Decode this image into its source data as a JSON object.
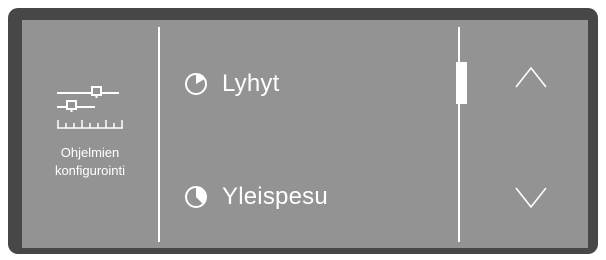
{
  "left_panel": {
    "icon": "settings-sliders-icon",
    "label_line1": "Ohjelmien",
    "label_line2": "konfigurointi"
  },
  "programs": [
    {
      "name": "Lyhyt",
      "icon": "pie-icon-small-slice"
    },
    {
      "name": "Yleispesu",
      "icon": "pie-icon-half"
    }
  ],
  "navigation": {
    "up_icon": "chevron-up-icon",
    "down_icon": "chevron-down-icon"
  },
  "colors": {
    "bezel": "#474747",
    "screen": "#939393",
    "foreground": "#ffffff"
  }
}
